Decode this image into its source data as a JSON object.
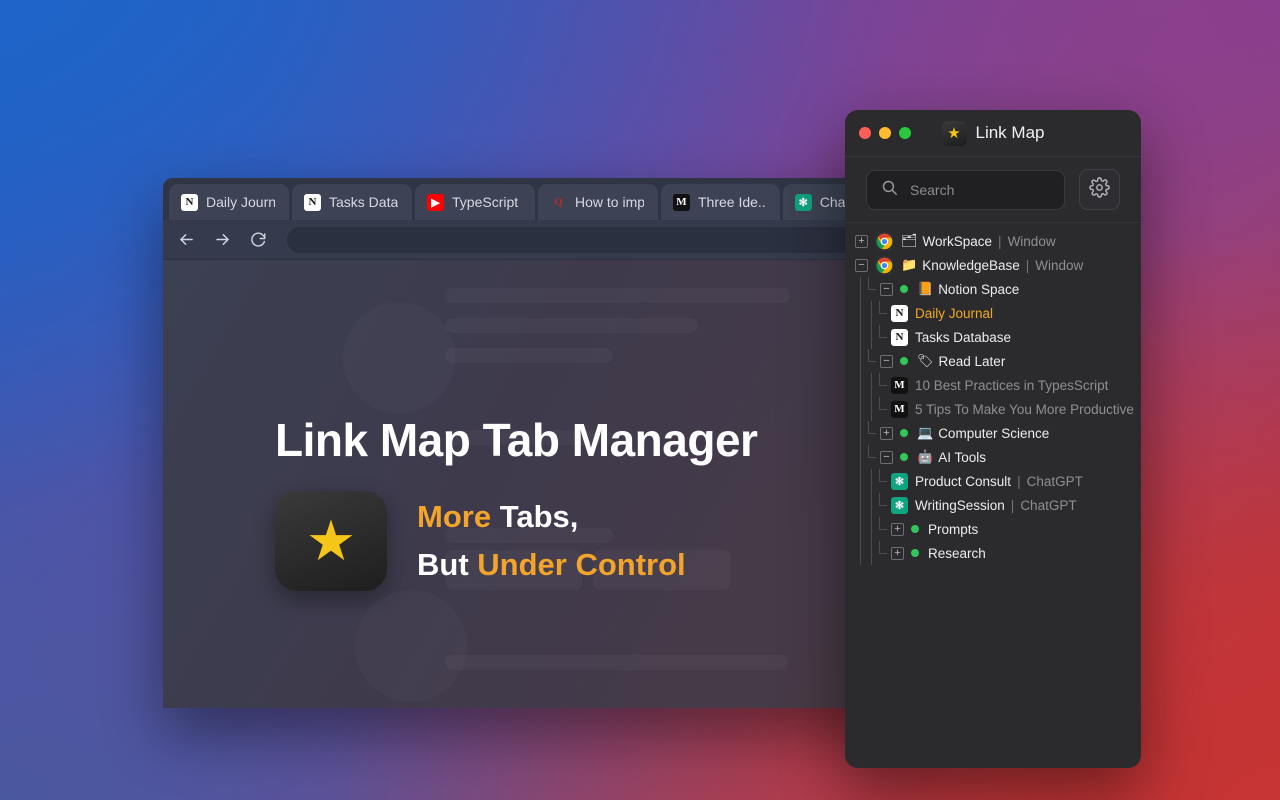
{
  "browser": {
    "tabs": [
      {
        "label": "Daily Journal",
        "icon": "notion-icon",
        "glyph": "N"
      },
      {
        "label": "Tasks Data..",
        "icon": "notion-icon",
        "glyph": "N"
      },
      {
        "label": "TypeScript ..",
        "icon": "youtube-icon",
        "glyph": "▶"
      },
      {
        "label": "How to imp..",
        "icon": "quora-icon",
        "glyph": "Q"
      },
      {
        "label": "Three Ide..",
        "icon": "medium-icon",
        "glyph": "M"
      },
      {
        "label": "ChatGPT",
        "icon": "chatgpt-icon",
        "glyph": "✻"
      }
    ],
    "toolbar": {
      "back": "←",
      "forward": "→",
      "reload": "⟳",
      "address_value": ""
    },
    "hero": {
      "title": "Link Map Tab Manager",
      "logo_glyph": "★",
      "line1_accent": "More",
      "line1_rest": " Tabs,",
      "line2_lead": "But ",
      "line2_accent": "Under Control"
    }
  },
  "panel": {
    "title": "Link Map",
    "title_icon_glyph": "★",
    "traffic_lights": [
      "close",
      "minimize",
      "zoom"
    ],
    "search": {
      "placeholder": "Search",
      "value": ""
    },
    "settings_label": "gear",
    "tree": [
      {
        "id": "workspace",
        "depth": 0,
        "toggle": "+",
        "browser_icon": "chrome-icon",
        "emoji": "🗂",
        "label": "WorkSpace",
        "suffix": "Window",
        "dot": false,
        "highlight": false
      },
      {
        "id": "knowledgebase",
        "depth": 0,
        "toggle": "−",
        "browser_icon": "chrome-icon",
        "emoji": "📁",
        "label": "KnowledgeBase",
        "suffix": "Window",
        "dot": false,
        "highlight": false
      },
      {
        "id": "notion-space",
        "depth": 1,
        "toggle": "−",
        "emoji": "📙",
        "label": "Notion Space",
        "dot": true,
        "highlight": false
      },
      {
        "id": "daily-journal",
        "depth": 2,
        "favicon": "notion-icon",
        "glyph": "N",
        "label": "Daily Journal",
        "dot": false,
        "highlight": true
      },
      {
        "id": "tasks-database",
        "depth": 2,
        "favicon": "notion-icon",
        "glyph": "N",
        "label": "Tasks Database",
        "dot": false,
        "highlight": false
      },
      {
        "id": "read-later",
        "depth": 1,
        "toggle": "−",
        "emoji": "🏷",
        "label": "Read Later",
        "dot": true,
        "highlight": false
      },
      {
        "id": "ts-best-practices",
        "depth": 2,
        "favicon": "medium-icon",
        "glyph": "M",
        "label": "10 Best Practices in TypesScript",
        "dim": true,
        "dot": false,
        "highlight": false
      },
      {
        "id": "five-tips",
        "depth": 2,
        "favicon": "medium-icon",
        "glyph": "M",
        "label": "5 Tips To Make You More Productive",
        "dim": true,
        "dot": false,
        "highlight": false
      },
      {
        "id": "computer-science",
        "depth": 1,
        "toggle": "+",
        "emoji": "💻",
        "label": "Computer Science",
        "dot": true,
        "highlight": false
      },
      {
        "id": "ai-tools",
        "depth": 1,
        "toggle": "−",
        "emoji": "🤖",
        "label": "AI Tools",
        "dot": true,
        "highlight": false
      },
      {
        "id": "product-consult",
        "depth": 2,
        "favicon": "chatgpt-icon",
        "glyph": "✻",
        "label": "Product Consult",
        "suffix": "ChatGPT",
        "dot": false,
        "highlight": false
      },
      {
        "id": "writing-session",
        "depth": 2,
        "favicon": "chatgpt-icon",
        "glyph": "✻",
        "label": "WritingSession",
        "suffix": "ChatGPT",
        "dot": false,
        "highlight": false
      },
      {
        "id": "prompts",
        "depth": 2,
        "toggle": "+",
        "label": "Prompts",
        "dot": true,
        "highlight": false
      },
      {
        "id": "research",
        "depth": 2,
        "toggle": "+",
        "label": "Research",
        "dot": true,
        "highlight": false
      }
    ]
  },
  "colors": {
    "accent_gold": "#f0a81f",
    "status_green": "#2fc65a",
    "panel_bg": "#2b2b2e",
    "chatgpt_green": "#10a37f",
    "gradient_start": "#1f5fc4",
    "gradient_end": "#bf3232"
  }
}
